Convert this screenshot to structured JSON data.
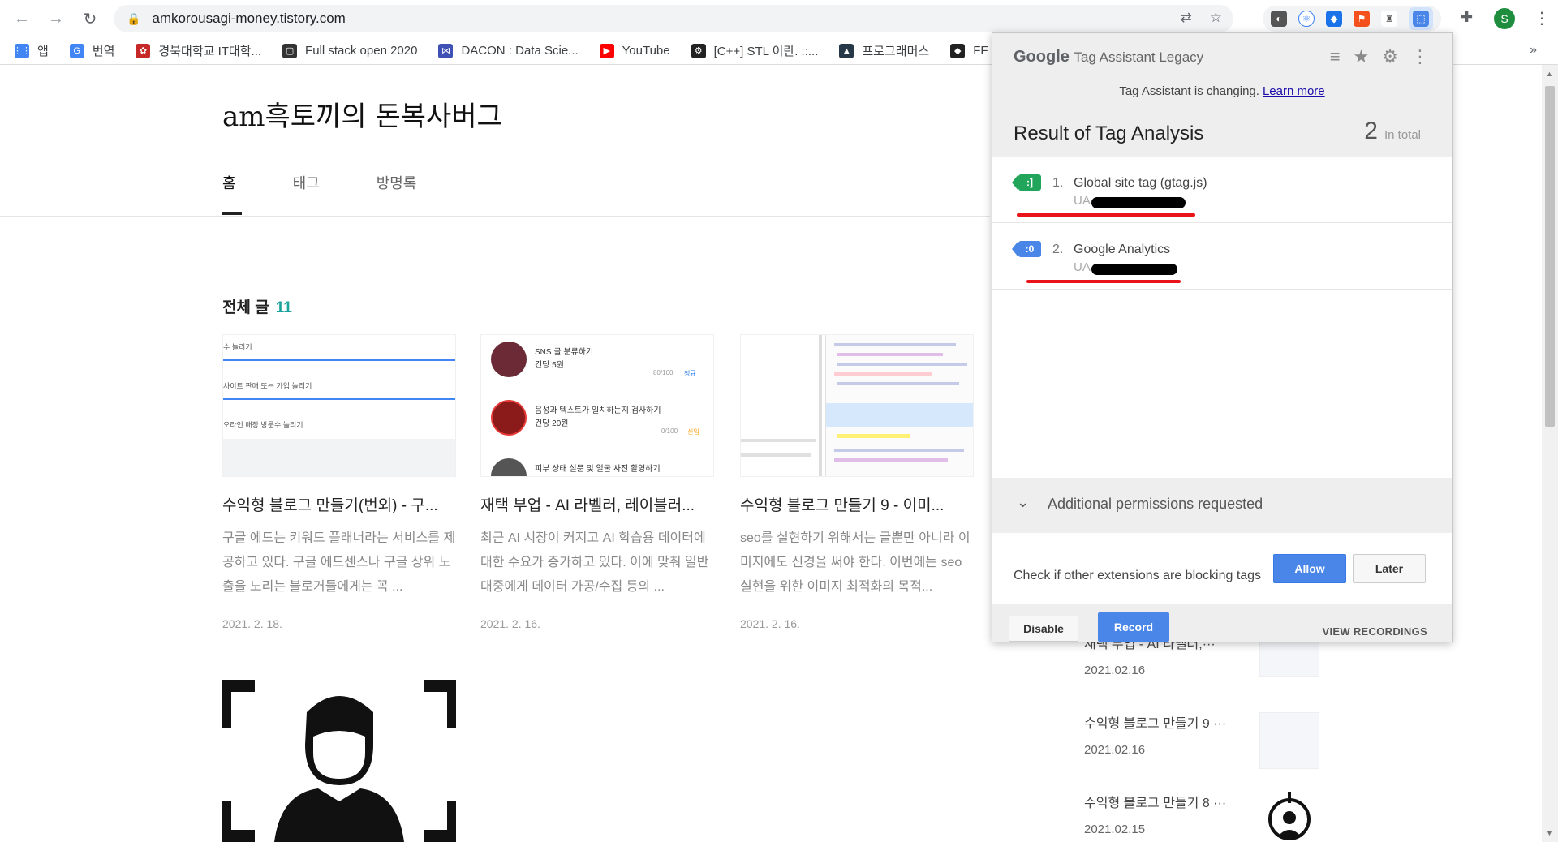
{
  "browser": {
    "url": "amkorousagi-money.tistory.com",
    "profile_initial": "S",
    "bookmarks": [
      {
        "label": "앱",
        "color": "#4285f4"
      },
      {
        "label": "번역",
        "color": "#4285f4"
      },
      {
        "label": "경북대학교 IT대학...",
        "color": "#c62828"
      },
      {
        "label": "Full stack open 2020",
        "color": "#333333"
      },
      {
        "label": "DACON : Data Scie...",
        "color": "#3f51b5"
      },
      {
        "label": "YouTube",
        "color": "#ff0000"
      },
      {
        "label": "[C++] STL 이란. ::...",
        "color": "#222222"
      },
      {
        "label": "프로그래머스",
        "color": "#263747"
      },
      {
        "label": "FF",
        "color": "#222222"
      }
    ],
    "bookmarks_more": "»"
  },
  "blog": {
    "title": "am흑토끼의 돈복사버그",
    "nav": [
      "홈",
      "태그",
      "방명록"
    ],
    "section_label": "전체 글",
    "section_count": "11",
    "cards": [
      {
        "title": "수익형 블로그 만들기(번외) - 구...",
        "desc": "구글 에드는 키워드 플래너라는 서비스를 제공하고 있다. 구글 에드센스나 구글 상위 노출을 노리는 블로거들에게는 꼭 ...",
        "date": "2021. 2. 18.",
        "thumb_lines": [
          "수 늘리기",
          "사이트 판매 또는 가입 늘리기",
          "오라인 매장 방문수 늘리기"
        ]
      },
      {
        "title": "재택 부업 - AI 라벨러, 레이블러...",
        "desc": "최근 AI 시장이 커지고 AI 학습용 데이터에 대한 수요가 증가하고 있다. 이에 맞춰 일반 대중에게 데이터 가공/수집 등의 ...",
        "date": "2021. 2. 16.",
        "thumb_items": [
          {
            "title": "SNS 글 분류하기",
            "sub": "건당 5원",
            "tag": "80/100",
            "badge": "정규"
          },
          {
            "title": "음성과 텍스트가 일치하는지 검사하기",
            "sub": "건당 20원",
            "tag": "0/100",
            "badge": "신입"
          },
          {
            "title": "피부 상태 설문 및 얼굴 사진 촬영하기",
            "sub": "",
            "tag": "",
            "badge": ""
          }
        ]
      },
      {
        "title": "수익형 블로그 만들기 9 - 이미...",
        "desc": "seo를 실현하기 위해서는 글뿐만 아니라 이미지에도 신경을 써야 한다. 이번에는 seo 실현을 위한 이미지 최적화의 목적...",
        "date": "2021. 2. 16."
      }
    ],
    "sidebar": [
      {
        "title": "재택 부업 - AI 라벨러,···",
        "date": "2021.02.16"
      },
      {
        "title": "수익형 블로그 만들기 9 ···",
        "date": "2021.02.16"
      },
      {
        "title": "수익형 블로그 만들기 8 ···",
        "date": "2021.02.15"
      }
    ]
  },
  "tag_assistant": {
    "brand": "Google",
    "product": "Tag Assistant Legacy",
    "notice": "Tag Assistant is changing.",
    "notice_link": "Learn more",
    "result_title": "Result of Tag Analysis",
    "total_count": "2",
    "total_label": "In total",
    "tags": [
      {
        "num": "1.",
        "name": "Global site tag (gtag.js)",
        "id_prefix": "UA-",
        "icon_color": "#21a55b"
      },
      {
        "num": "2.",
        "name": "Google Analytics",
        "id_prefix": "UA-",
        "icon_color": "#4a86e8"
      }
    ],
    "permissions_label": "Additional permissions requested",
    "check_text": "Check if other extensions are blocking tags",
    "allow_label": "Allow",
    "later_label": "Later",
    "disable_label": "Disable",
    "record_label": "Record",
    "view_recordings_label": "VIEW RECORDINGS"
  }
}
